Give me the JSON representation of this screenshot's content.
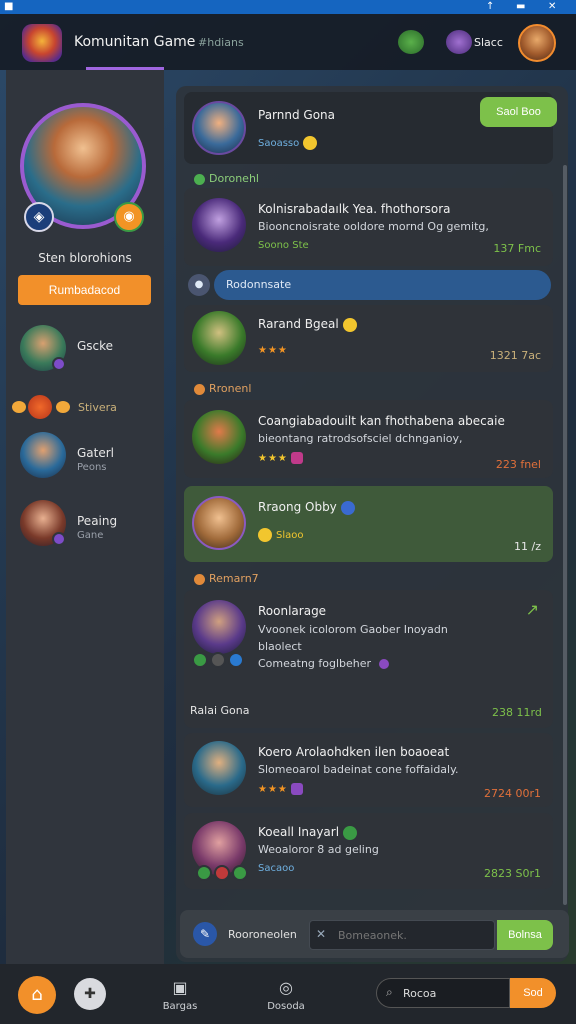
{
  "app": {
    "title": "Komunitan Game",
    "subtitle": "#hdians",
    "user_label": "Slacc"
  },
  "colors": {
    "accent": "#f2902a",
    "green": "#7dc14a",
    "purple": "#9a5bd0",
    "blue": "#2c5a90"
  },
  "sidebar": {
    "profile_name": "Sten blorohions",
    "profile_button": "Rumbadacod",
    "friends": [
      {
        "name": "Gscke",
        "status": ""
      },
      {
        "name": "Gaterl",
        "status": "Peons"
      },
      {
        "name": "Peaing",
        "status": "Gane"
      }
    ],
    "streak_label": "Stivera"
  },
  "feed": {
    "header": {
      "title": "Parnnd Gona",
      "meta": "Saoasso",
      "join": "Saol Boo"
    },
    "sections": [
      "Doronehl",
      "Rronenl",
      "Remarn7"
    ],
    "pill": {
      "icon_text": "",
      "label": "Rodonnsate"
    },
    "cards": [
      {
        "title": "Kolnisrabadaılk Yea. fhothorsora",
        "line": "Biooncnoisrate ooldore mornd Og gemitg,",
        "meta": "Soono Ste",
        "time": "137 Fmc"
      },
      {
        "title": "Rarand Bgeal",
        "line": "",
        "meta": "",
        "time": "1321 7ac"
      },
      {
        "title": "Coangiabadouilt kan fhothabena abecaie",
        "line": "bieontang ratrodsofsciel dchnganioy,",
        "meta": "",
        "time": "223 fnel"
      },
      {
        "title": "Rraong Obby",
        "line": "",
        "meta": "Slaoo",
        "time": "11 /z"
      },
      {
        "title": "Roonlarage",
        "line": "Vvoonek icolorom Gaober Inoyadn",
        "line2": "blaolect",
        "line3": "Comeatng foglbeher",
        "meta": "",
        "time": ""
      },
      {
        "title": "Koero Arolaohdken ilen boaoeat",
        "line": "Slomeoarol badeinat cone foffaidaly.",
        "meta": "",
        "time": "2724 00r1"
      },
      {
        "title": "Koeall Inayarl",
        "line": "Weoaloror 8 ad geling",
        "meta": "Sacaoo",
        "time": "2823 S0r1"
      }
    ],
    "user_row": {
      "name": "Ralai Gona",
      "time": "238 11rd"
    }
  },
  "composer": {
    "label": "Rooroneolen",
    "placeholder": "Bomeaonek.",
    "send": "Bolnsa"
  },
  "bottom_nav": {
    "items": [
      {
        "label": "Bargas"
      },
      {
        "label": "Dosoda"
      }
    ],
    "search_value": "Rocoa",
    "go": "Sod"
  }
}
